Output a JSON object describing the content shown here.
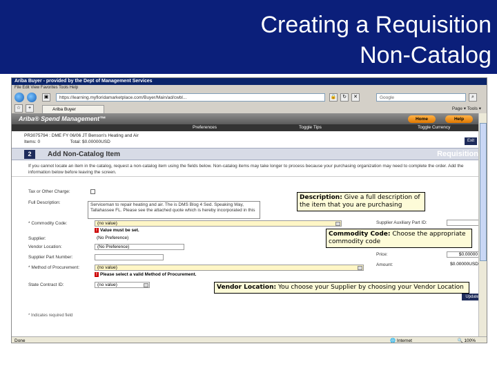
{
  "slide": {
    "title_line1": "Creating a Requisition",
    "title_line2": "Non-Catalog",
    "title_bg": "#0b1f7a"
  },
  "browser": {
    "window_title": "Ariba Buyer - provided by the Dept of Management Services",
    "menu": "File  Edit  View  Favorites  Tools  Help",
    "address": "https://learning.myfloridamarketplace.com/Buyer/Main/ad/cwbl...",
    "search_placeholder": "Google",
    "tab_label": "Ariba Buyer",
    "tools_label": "Page ▾   Tools ▾",
    "status_left": "Done",
    "status_zone": "Internet",
    "status_zoom": "100%"
  },
  "ariba": {
    "brand": "Ariba® Spend Management™",
    "home_button": "Home",
    "help_button": "Help",
    "nav": {
      "preferences": "Preferences",
      "toggle_tips": "Toggle Tips",
      "toggle_currency": "Toggle Currency"
    },
    "req_title": "PR3075794 : DME FY 06/06 JT Benson's Heating and Air",
    "items": "Items: 0",
    "total": "Total: $0.00000USD",
    "step_number": "2",
    "step_title": "Add Non-Catalog Item",
    "step_right": "Requisition",
    "exit_button": "Exit",
    "instructions": "If you cannot locate an item in the catalog, request a non-catalog item using the fields below. Non-catalog items may take longer to process because your purchasing organization may need to complete the order. Add the information below before leaving the screen."
  },
  "form": {
    "tax_label": "Tax or Other Charge:",
    "description_label": "Full Description:",
    "description_value": "Serviceman to repair heating and air. The is DMS Blog 4 Sed. Speaking Way, Tallahassee FL. Please see the attached quote which is hereby incorporated in this",
    "commodity_label": "* Commodity Code:",
    "commodity_value": "(no value)",
    "commodity_error": "Value must be set.",
    "supplier_label": "Supplier:",
    "supplier_value": "(No Preference)",
    "vendor_label": "Vendor Location:",
    "vendor_value": "(No Preference)",
    "part_label": "Supplier Part Number:",
    "method_label": "* Method of Procurement:",
    "method_value": "(no value)",
    "method_error": "Please select a valid Method of Procurement.",
    "contract_label": "State Contract ID:",
    "contract_value": "(no value)",
    "aux_label": "Supplier Auxiliary Part ID:",
    "price_label": "Price:",
    "price_value": "$0.00000",
    "amount_label": "Amount:",
    "amount_value": "$0.00000USD",
    "update_button": "Update",
    "required_note": "* Indicates required field"
  },
  "callouts": {
    "description_title": "Description:",
    "description_text": " Give a full description of the item that you are purchasing",
    "commodity_title": "Commodity Code:",
    "commodity_text": "  Choose the appropriate commodity code",
    "vendor_title": "Vendor Location:",
    "vendor_text": "  You choose your Supplier by choosing your Vendor Location"
  }
}
